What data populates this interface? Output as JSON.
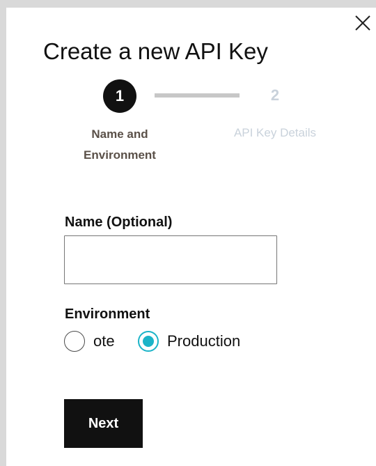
{
  "dialog": {
    "title": "Create a new API Key",
    "close_icon": "close-icon"
  },
  "stepper": {
    "current_step": 1,
    "steps": [
      {
        "number": "1",
        "label": "Name and Environment",
        "label_line1": "Name and",
        "label_line2": "Environment",
        "state": "active"
      },
      {
        "number": "2",
        "label": "API Key Details",
        "state": "inactive"
      }
    ]
  },
  "form": {
    "name_label": "Name (Optional)",
    "name_value": "",
    "environment_label": "Environment",
    "environment_options": [
      {
        "label": "ote",
        "selected": false
      },
      {
        "label": "Production",
        "selected": true
      }
    ],
    "next_label": "Next"
  },
  "colors": {
    "accent": "#1bb4c8",
    "primary_button": "#111111",
    "inactive_step": "#c9d2db",
    "step_line": "#c7c7c7",
    "active_step_label": "#5a5048"
  }
}
